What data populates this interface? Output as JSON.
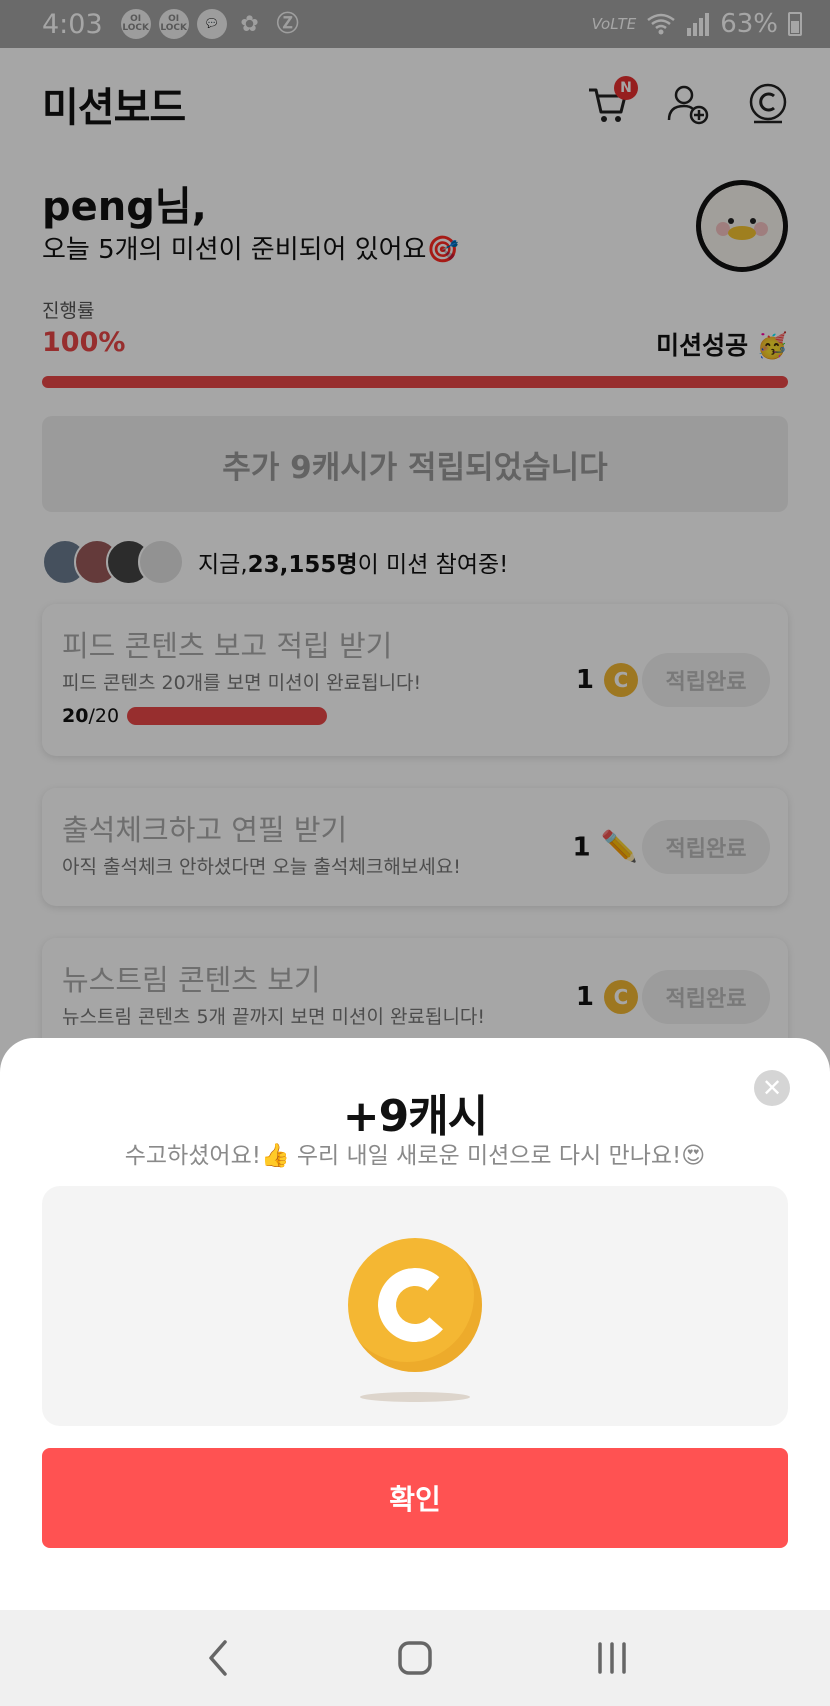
{
  "status_bar": {
    "time": "4:03",
    "notif_icons": [
      "OI LOCK",
      "OI LOCK",
      "chat",
      "apps",
      "Z"
    ],
    "network": "VoLTE",
    "battery": "63%"
  },
  "header": {
    "title": "미션보드",
    "cart_badge": "N"
  },
  "greeting": {
    "name": "peng님,",
    "subtitle": "오늘 5개의 미션이 준비되어 있어요🎯"
  },
  "progress": {
    "label": "진행률",
    "percent_text": "100%",
    "value": 1.0,
    "status": "미션성공 🥳"
  },
  "banner": {
    "text": "추가 9캐시가 적립되었습니다"
  },
  "participants": {
    "prefix": "지금, ",
    "count": "23,155명",
    "suffix": "이 미션 참여중!"
  },
  "missions": [
    {
      "title": "피드 콘텐츠 보고 적립 받기",
      "desc": "피드 콘텐츠 20개를 보면 미션이 완료됩니다!",
      "progress_done": "20",
      "progress_total": "/20",
      "reward": "1",
      "reward_icon": "coin-icon",
      "button": "적립완료"
    },
    {
      "title": "출석체크하고 연필 받기",
      "desc": "아직 출석체크 안하셨다면 오늘 출석체크해보세요!",
      "reward": "1",
      "reward_icon": "pencil-icon",
      "button": "적립완료"
    },
    {
      "title": "뉴스트림 콘텐츠 보기",
      "desc": "뉴스트림 콘텐츠 5개 끝까지 보면 미션이 완료됩니다!",
      "reward": "1",
      "reward_icon": "coin-icon",
      "button": "적립완료"
    }
  ],
  "sheet": {
    "amount": "+9캐시",
    "message": "수고하셨어요!👍 우리 내일 새로운 미션으로 다시 만나요!😍",
    "confirm": "확인",
    "coin_letter": "C"
  },
  "colors": {
    "accent": "#e84848",
    "confirm_button": "#ff5252",
    "coin": "#f4b733"
  }
}
